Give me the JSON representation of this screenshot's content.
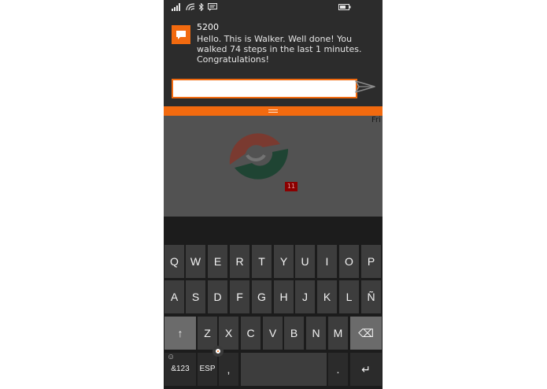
{
  "colors": {
    "accent": "#f26a0f",
    "logo_red": "#c0392b",
    "logo_green": "#1f5b3a",
    "badge_bg": "#8b0000"
  },
  "status_bar": {
    "icons": [
      "signal-icon",
      "wifi-icon",
      "bluetooth-icon",
      "message-icon",
      "battery-icon"
    ]
  },
  "notification": {
    "app_icon": "chat-bubble-icon",
    "title": "5200",
    "message": "Hello. This is Walker. Well done! You walked 74 steps in the last 1 minutes. Congratulations!",
    "reply_value": "",
    "send_icon": "send-icon"
  },
  "app": {
    "day_label": "Fri",
    "badge": "11"
  },
  "keyboard": {
    "rows": [
      [
        "Q",
        "W",
        "E",
        "R",
        "T",
        "Y",
        "U",
        "I",
        "O",
        "P"
      ],
      [
        "A",
        "S",
        "D",
        "F",
        "G",
        "H",
        "J",
        "K",
        "L",
        "Ñ"
      ],
      [
        "↑",
        "Z",
        "X",
        "C",
        "V",
        "B",
        "N",
        "M",
        "⌫"
      ]
    ],
    "bottom": {
      "symbols": "&123",
      "emoji": "☺",
      "language": "ESP",
      "comma": ",",
      "space": "",
      "period": ".",
      "enter": "↵"
    }
  }
}
